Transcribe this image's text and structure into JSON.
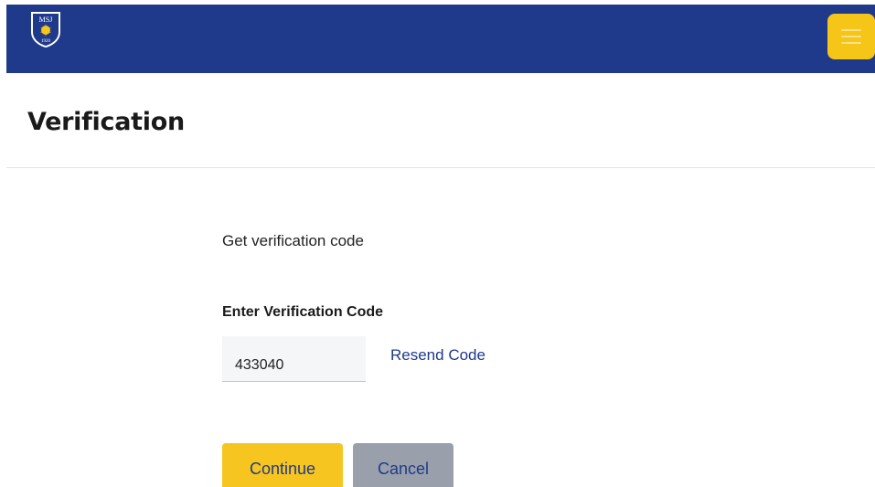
{
  "header": {
    "logo": {
      "text_top": "MSJ",
      "text_bottom": "1920",
      "icon": "crest-icon"
    },
    "menu_icon": "hamburger-menu-icon",
    "colors": {
      "bar": "#1f3a8a",
      "menu_button": "#f5c518"
    }
  },
  "page": {
    "title": "Verification"
  },
  "form": {
    "intro": "Get verification code",
    "code_label": "Enter Verification Code",
    "code_value": "433040",
    "resend_label": "Resend Code",
    "continue_label": "Continue",
    "cancel_label": "Cancel"
  }
}
